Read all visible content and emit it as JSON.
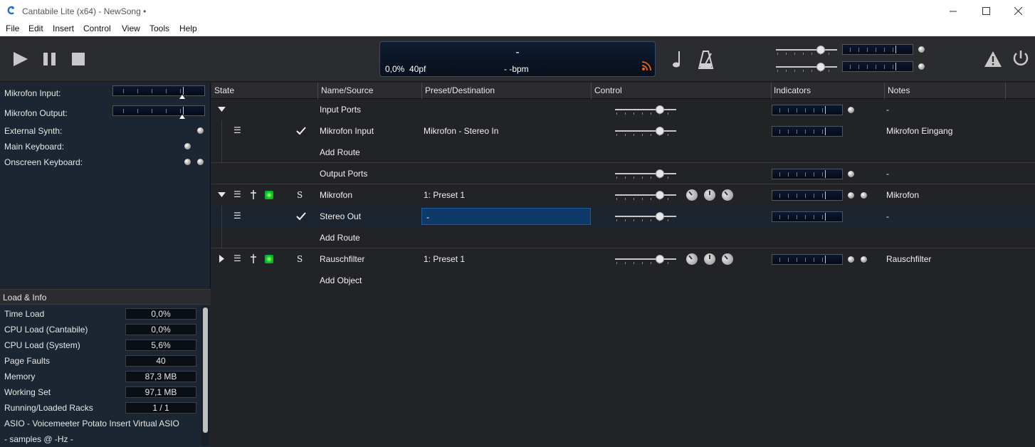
{
  "window": {
    "title": "Cantabile Lite (x64) - NewSong •",
    "controls": [
      "minimize-icon",
      "maximize-icon",
      "close-icon"
    ]
  },
  "menu": [
    "File",
    "Edit",
    "Insert",
    "Control",
    "View",
    "Tools",
    "Help"
  ],
  "toolbar": {
    "transport": [
      "play-icon",
      "pause-icon",
      "stop-icon"
    ],
    "display": {
      "center": "-",
      "load": "0,0%",
      "pf": "40pf",
      "bpm": "- -bpm"
    },
    "right_icons": [
      "note-icon",
      "metronome-icon",
      "warning-icon",
      "power-icon"
    ]
  },
  "left": {
    "routes": [
      {
        "label": "Mikrofon Input:"
      },
      {
        "label": "Mikrofon Output:"
      },
      {
        "label": "External Synth:"
      },
      {
        "label": "Main Keyboard:"
      },
      {
        "label": "Onscreen Keyboard:"
      }
    ],
    "load_header": "Load & Info",
    "info": [
      {
        "label": "Time Load",
        "value": "0,0%"
      },
      {
        "label": "CPU Load (Cantabile)",
        "value": "0,0%"
      },
      {
        "label": "CPU Load (System)",
        "value": "5,6%"
      },
      {
        "label": "Page Faults",
        "value": "40"
      },
      {
        "label": "Memory",
        "value": "87,3 MB"
      },
      {
        "label": "Working Set",
        "value": "97,1 MB"
      },
      {
        "label": "Running/Loaded Racks",
        "value": "1 / 1"
      }
    ],
    "asio": "ASIO - Voicemeeter Potato Insert Virtual ASIO",
    "samples": "- samples @ -Hz -"
  },
  "columns": [
    "State",
    "Name/Source",
    "Preset/Destination",
    "Control",
    "Indicators",
    "Notes"
  ],
  "rows": [
    {
      "name": "Input Ports",
      "preset": "",
      "notes": "-"
    },
    {
      "name": "Mikrofon Input",
      "preset": "Mikrofon - Stereo In",
      "notes": "Mikrofon Eingang"
    },
    {
      "name": "Add Route",
      "preset": "",
      "notes": ""
    },
    {
      "name": "Output Ports",
      "preset": "",
      "notes": "-"
    },
    {
      "name": "Mikrofon",
      "preset": "1: Preset 1",
      "notes": "Mikrofon",
      "solo": "S"
    },
    {
      "name": "Stereo Out",
      "preset": "-",
      "notes": "-"
    },
    {
      "name": "Add Route",
      "preset": "",
      "notes": ""
    },
    {
      "name": "Rauschfilter",
      "preset": "1: Preset 1",
      "notes": "Rauschfilter",
      "solo": "S"
    },
    {
      "name": "Add Object",
      "preset": "",
      "notes": ""
    }
  ],
  "colors": {
    "accent_led": "#30e030",
    "display_bg": "#0a1424",
    "panel_bg": "#1b2632"
  }
}
